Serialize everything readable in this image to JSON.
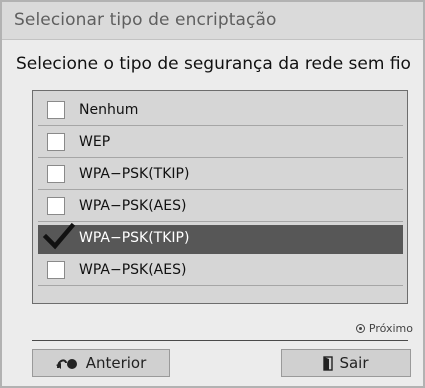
{
  "dialog": {
    "title": "Selecionar tipo de encriptação",
    "subtitle": "Selecione o tipo de segurança da rede sem fio"
  },
  "options": [
    {
      "label": "Nenhum",
      "checked": false,
      "highlighted": false
    },
    {
      "label": "WEP",
      "checked": false,
      "highlighted": false
    },
    {
      "label": "WPA−PSK(TKIP)",
      "checked": false,
      "highlighted": false
    },
    {
      "label": "WPA−PSK(AES)",
      "checked": false,
      "highlighted": false
    },
    {
      "label": "WPA−PSK(TKIP)",
      "checked": true,
      "highlighted": true
    },
    {
      "label": "WPA−PSK(AES)",
      "checked": false,
      "highlighted": false
    }
  ],
  "footer": {
    "next_hint": "Próximo",
    "prev_label": "Anterior",
    "exit_label": "Sair"
  },
  "colors": {
    "dialog_bg": "#ececec",
    "title_bg": "#dadada",
    "list_bg": "#d6d6d6",
    "highlight_bg": "#575757"
  },
  "icons": {
    "next_hint": "ok-button-icon",
    "prev": "remote-back-icon",
    "exit": "exit-door-icon",
    "check": "check-mark-icon"
  }
}
